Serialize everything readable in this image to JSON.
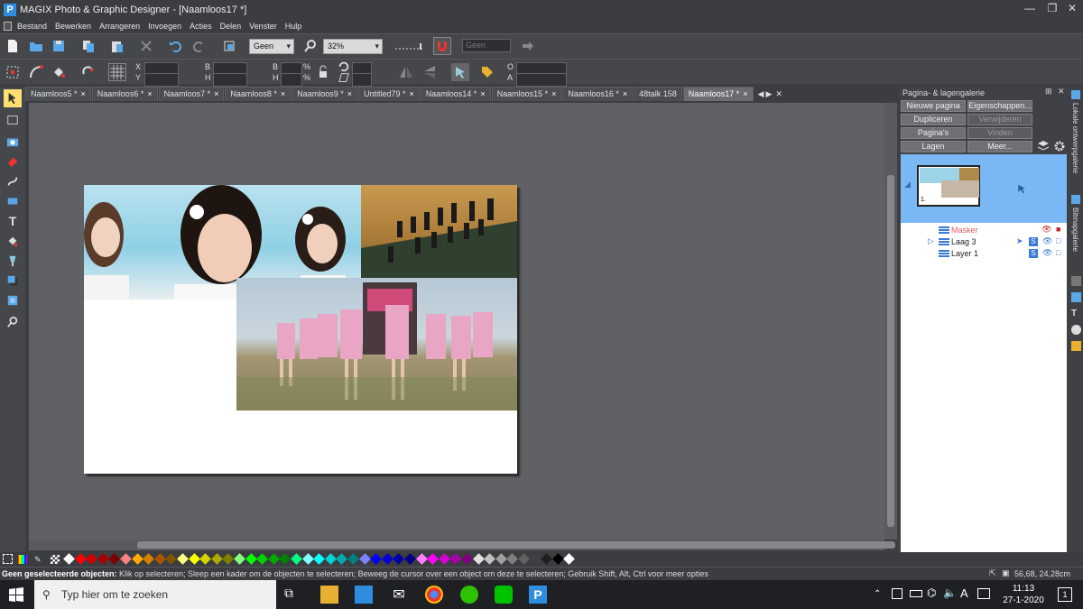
{
  "window": {
    "logo_letter": "P",
    "title": "MAGIX Photo & Graphic Designer - [Naamloos17 *]",
    "btn_min": "—",
    "btn_max": "❐",
    "btn_close": "✕"
  },
  "menu": [
    "Bestand",
    "Bewerken",
    "Arrangeren",
    "Invoegen",
    "Acties",
    "Delen",
    "Venster",
    "Hulp"
  ],
  "toolbar1": {
    "line_style": "Geen",
    "zoom": "32%",
    "fill_value": "Geen"
  },
  "toolbar2": {
    "x_label": "X",
    "y_label": "Y",
    "w_label": "B",
    "h_label": "H",
    "sw_label": "B",
    "sh_label": "H",
    "pct1": "%",
    "pct2": "%",
    "o_label": "O",
    "a_label": "A"
  },
  "tabs": [
    "Naamloos5 *",
    "Naamloos6 *",
    "Naamloos7 *",
    "Naamloos8 *",
    "Naamloos9 *",
    "Untitled79 *",
    "Naamloos14 *",
    "Naamloos15 *",
    "Naamloos16 *",
    "48talk 158",
    "Naamloos17 *"
  ],
  "tab_close": "×",
  "tab_nav": [
    "◀",
    "▶",
    "✕"
  ],
  "panel": {
    "title": "Pagina- & lagengalerie",
    "pin": "⊞",
    "close": "✕",
    "buttons": {
      "new_page": "Nieuwe pagina",
      "properties": "Eigenschappen...",
      "duplicate": "Dupliceren",
      "delete": "Verwijderen",
      "pages": "Pagina's",
      "find": "Vinden",
      "layers": "Lagen",
      "more": "Meer..."
    },
    "page_number": "1.",
    "layers": [
      {
        "name": "Masker",
        "color": "#e05a5a"
      },
      {
        "name": "Laag 3",
        "color": "#222222"
      },
      {
        "name": "Layer 1",
        "color": "#222222"
      }
    ]
  },
  "side_labels": {
    "local": "Lokale ontwerpgalerie",
    "bitmap": "Bitmapgalerie"
  },
  "status": {
    "bold": "Geen geselecteerde objecten:",
    "text": " Klik op selecteren; Sleep een kader om de objecten te selecteren; Beweeg de cursor over een object om deze te selecteren; Gebruik Shift, Alt, Ctrl voor meer opties",
    "coords": "56,68, 24,28cm"
  },
  "taskbar": {
    "search_placeholder": "Typ hier om te zoeken",
    "time": "11:13",
    "date": "27-1-2020",
    "notif": "1",
    "lang": "A"
  },
  "palette": [
    "#ffffff",
    "#ff0000",
    "#d40000",
    "#aa0000",
    "#800000",
    "#ff8080",
    "#ffaa00",
    "#d48000",
    "#aa5500",
    "#805500",
    "#ffff80",
    "#ffff00",
    "#d4d400",
    "#aaaa00",
    "#808000",
    "#80ff80",
    "#00ff00",
    "#00d400",
    "#00aa00",
    "#008000",
    "#00ff80",
    "#80ffff",
    "#00ffff",
    "#00d4d4",
    "#00aaaa",
    "#008080",
    "#8080ff",
    "#0000ff",
    "#0000d4",
    "#0000aa",
    "#000080",
    "#ff80ff",
    "#ff00ff",
    "#d400d4",
    "#aa00aa",
    "#800080",
    "#e0e0e0",
    "#c0c0c0",
    "#a0a0a0",
    "#808080",
    "#606060",
    "#404040",
    "#202020",
    "#000000",
    "#ffffff"
  ],
  "colors": {
    "accent": "#7ab8f5",
    "bg": "#5f6165",
    "panel": "#3f4145"
  }
}
